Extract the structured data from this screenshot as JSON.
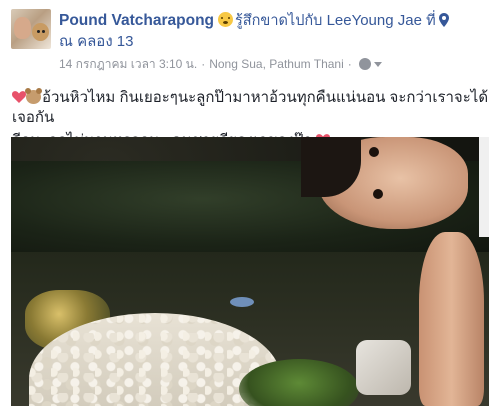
{
  "post": {
    "author": "Pound Vatcharapong",
    "feeling_text": "รู้สึกขาดไปกับ",
    "with_name": "LeeYoung Jae",
    "at_word": "ที่",
    "place_line": "ณ คลอง 13",
    "timestamp": "14 กรกฎาคม เวลา 3:10 น.",
    "meta_dot": "·",
    "location": "Nong Sua, Pathum Thani",
    "text_line1": "อ้วนหิวไหม กินเยอะๆนะลูกป๊ามาหาอ้วนทุกคืนแน่นอน จะกว่าเราจะได้เจอกัน",
    "text_line2": "อีกนะลูกไม่นานหรอกนะ คุนชายลียองเจของป๊า"
  },
  "icons": {
    "feeling": "emoji-feeling-icon",
    "location": "location-pin-icon",
    "privacy": "globe-icon",
    "privacy_menu": "chevron-down-icon",
    "heart": "heart-icon",
    "bear": "bear-icon"
  },
  "colors": {
    "link": "#365899",
    "meta": "#90949c",
    "text": "#1d2129",
    "heart": "#e8526a"
  }
}
